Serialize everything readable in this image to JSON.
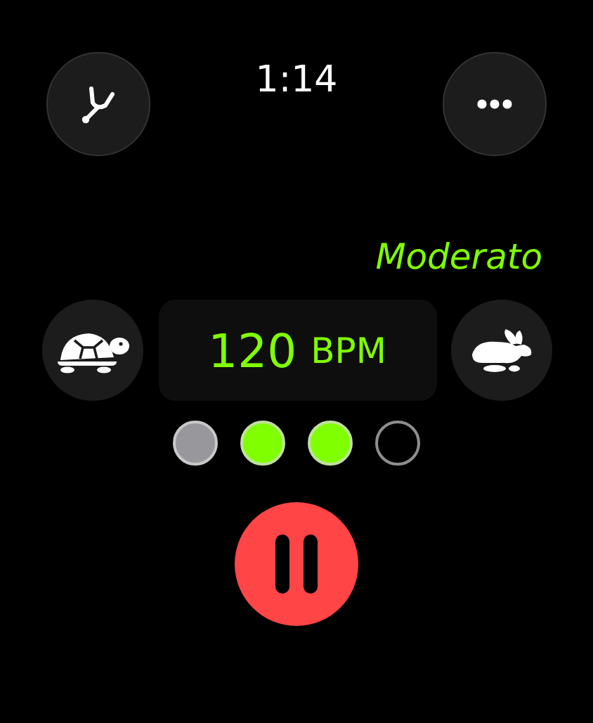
{
  "time": "1:14",
  "tempo_name": "Moderato",
  "bpm": {
    "value": "120",
    "unit": "BPM"
  },
  "beats": [
    {
      "kind": "past"
    },
    {
      "kind": "active"
    },
    {
      "kind": "active"
    },
    {
      "kind": "pending"
    }
  ],
  "playing": true
}
